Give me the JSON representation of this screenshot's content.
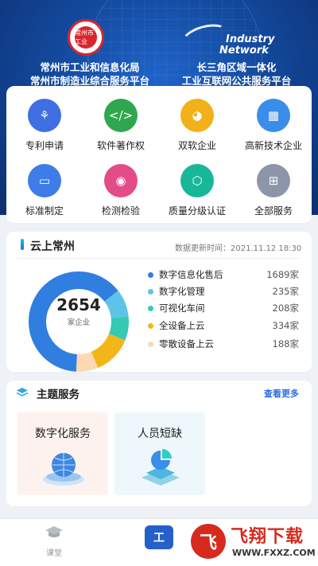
{
  "header": {
    "left_logo_text": "常州市工业",
    "left_org_line1": "常州市工业和信息化局",
    "left_org_line2": "常州市制造业综合服务平台",
    "right_logo_line1": "Industry",
    "right_logo_line2": "Network",
    "right_org_line1": "长三角区域一体化",
    "right_org_line2": "工业互联网公共服务平台"
  },
  "services": [
    {
      "label": "专利申请",
      "icon": "patent-icon",
      "color": "#3f6fe0",
      "glyph": "⚘"
    },
    {
      "label": "软件著作权",
      "icon": "code-window-icon",
      "color": "#2fa74f",
      "glyph": "</>"
    },
    {
      "label": "双软企业",
      "icon": "pie-chart-icon",
      "color": "#f2b11b",
      "glyph": "◕"
    },
    {
      "label": "高新技术企业",
      "icon": "building-icon",
      "color": "#3a8de8",
      "glyph": "▦"
    },
    {
      "label": "标准制定",
      "icon": "ruler-icon",
      "color": "#3e7ce8",
      "glyph": "▭"
    },
    {
      "label": "检测检验",
      "icon": "camera-icon",
      "color": "#e44c89",
      "glyph": "◉"
    },
    {
      "label": "质量分级认证",
      "icon": "shield-check-icon",
      "color": "#19b79a",
      "glyph": "⬡"
    },
    {
      "label": "全部服务",
      "icon": "grid-icon",
      "color": "#8d96a8",
      "glyph": "⊞"
    }
  ],
  "cloud": {
    "title": "云上常州",
    "update_time": "数据更新时间：2021.11.12  18:30",
    "total": "2654",
    "total_label": "家企业"
  },
  "chart_data": {
    "type": "pie",
    "series": [
      {
        "name": "数字信息化售后",
        "value": 1689,
        "display": "1689家",
        "color": "#2f7ee0"
      },
      {
        "name": "数字化管理",
        "value": 235,
        "display": "235家",
        "color": "#5ec3e8"
      },
      {
        "name": "可视化车间",
        "value": 208,
        "display": "208家",
        "color": "#36c9b4"
      },
      {
        "name": "全设备上云",
        "value": 334,
        "display": "334家",
        "color": "#f2b619"
      },
      {
        "name": "零散设备上云",
        "value": 188,
        "display": "188家",
        "color": "#fbd9b2"
      }
    ]
  },
  "theme": {
    "title": "主题服务",
    "more": "查看更多",
    "tiles": [
      {
        "label": "数字化服务",
        "bg": "#fdf2ee"
      },
      {
        "label": "人员短缺",
        "bg": "#eef7fb"
      }
    ]
  },
  "nav": {
    "classroom": "课堂",
    "work": "工"
  },
  "watermark": {
    "glyph": "飞",
    "line1": "飞翔下载",
    "line2": "WWW.FXXZ.COM"
  }
}
